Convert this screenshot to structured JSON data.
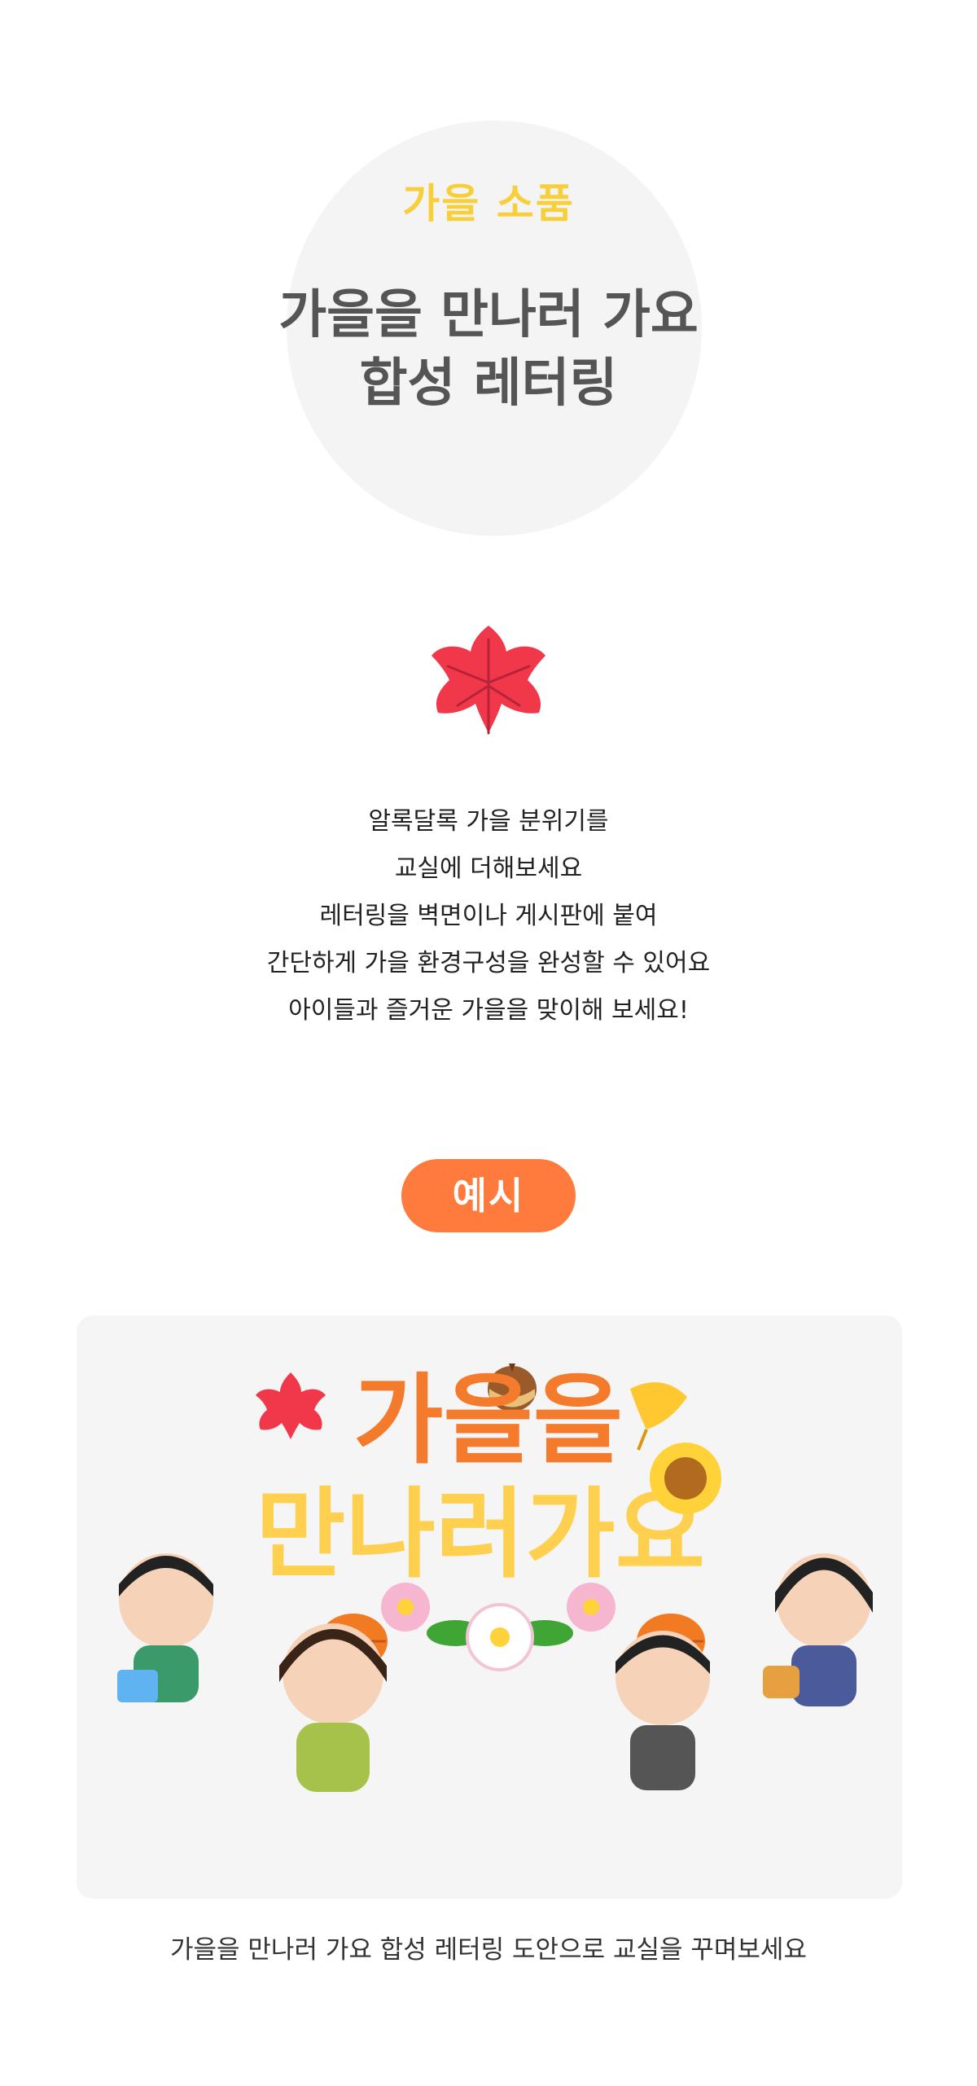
{
  "header": {
    "subtitle": "가을 소품",
    "title_line1": "가을을 만나러 가요",
    "title_line2": "합성 레터링"
  },
  "description": [
    "알록달록 가을 분위기를",
    "교실에 더해보세요",
    "레터링을 벽면이나 게시판에 붙여",
    "간단하게 가을 환경구성을 완성할 수 있어요",
    "아이들과 즐거운 가을을 맞이해 보세요!"
  ],
  "example_button": "예시",
  "example": {
    "lettering_line1": "가을을",
    "lettering_line2": "만나러가요"
  },
  "caption": "가을을 만나러 가요 합성 레터링 도안으로 교실을 꾸며보세요",
  "colors": {
    "subtitle": "#f6cf3a",
    "title": "#555555",
    "pill": "#ff7a3d",
    "circle": "#f4f4f4",
    "card": "#f5f5f5",
    "leaf_red": "#f0384a",
    "lettering_orange": "#f37b2b",
    "lettering_yellow": "#ffd04f"
  }
}
